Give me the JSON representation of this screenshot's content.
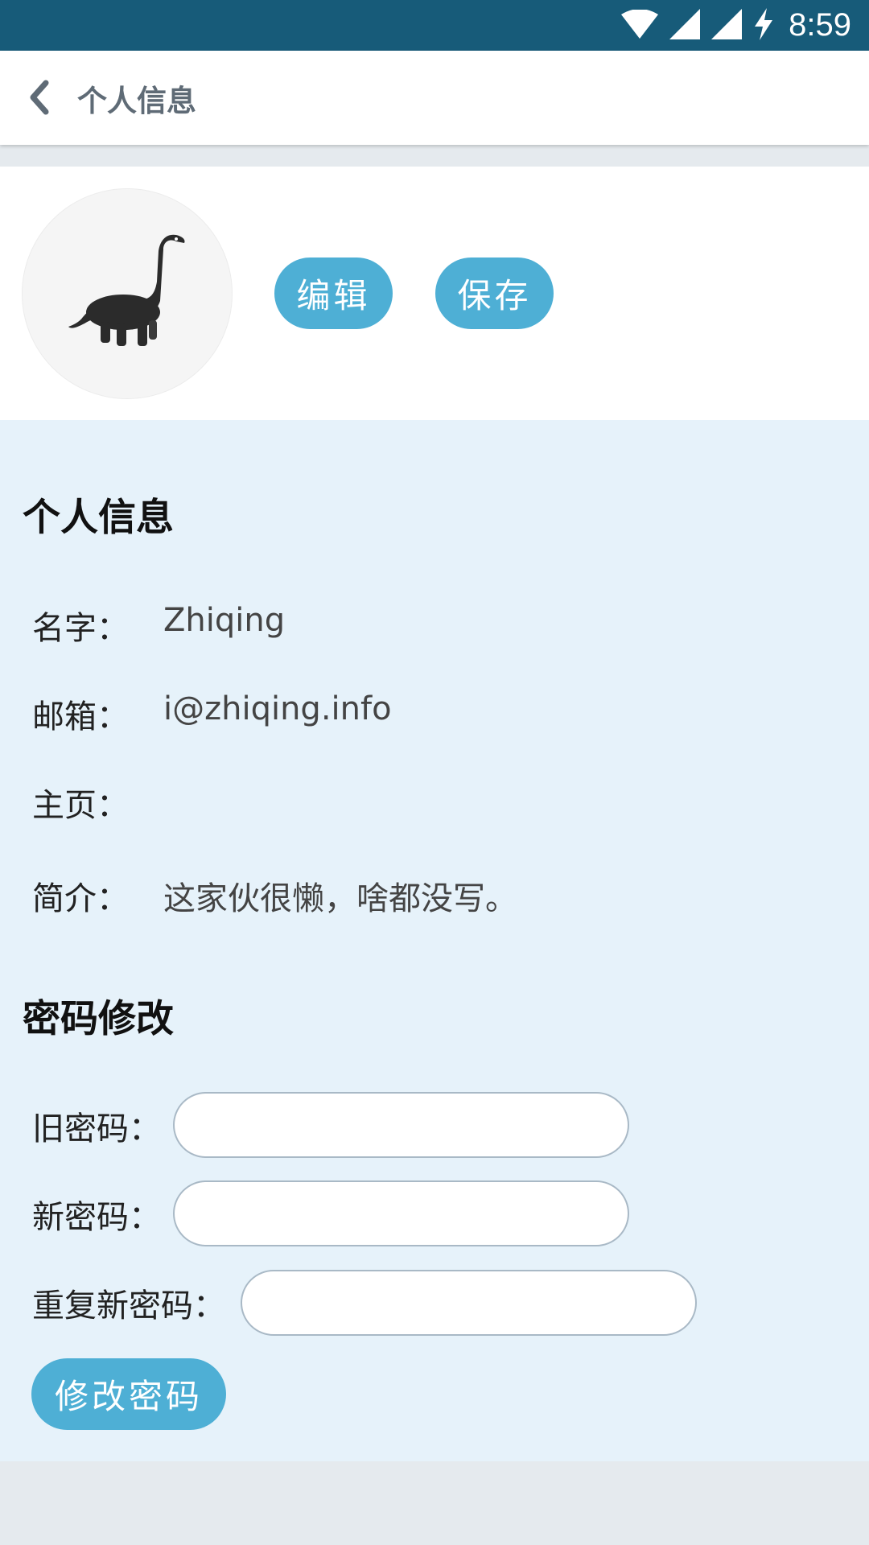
{
  "status_bar": {
    "time": "8:59",
    "icons": [
      "wifi-icon",
      "cell-signal-icon",
      "cell-signal-icon",
      "charging-bolt-icon"
    ]
  },
  "app_bar": {
    "title": "个人信息",
    "back_icon": "chevron-left-icon"
  },
  "profile": {
    "avatar_icon": "dinosaur-avatar",
    "edit_label": "编辑",
    "save_label": "保存"
  },
  "info_section": {
    "title": "个人信息",
    "rows": [
      {
        "label": "名字：",
        "value": "Zhiqing"
      },
      {
        "label": "邮箱：",
        "value": "i@zhiqing.info"
      },
      {
        "label": "主页：",
        "value": ""
      },
      {
        "label": "简介：",
        "value": "这家伙很懒，啥都没写。"
      }
    ]
  },
  "password_section": {
    "title": "密码修改",
    "old_label": "旧密码：",
    "new_label": "新密码：",
    "repeat_label": "重复新密码：",
    "old_value": "",
    "new_value": "",
    "repeat_value": "",
    "submit_label": "修改密码"
  },
  "colors": {
    "status_bar": "#175b79",
    "accent_button": "#4eafd5",
    "content_bg": "#e6f2fa",
    "page_bg": "#e5eaee"
  }
}
